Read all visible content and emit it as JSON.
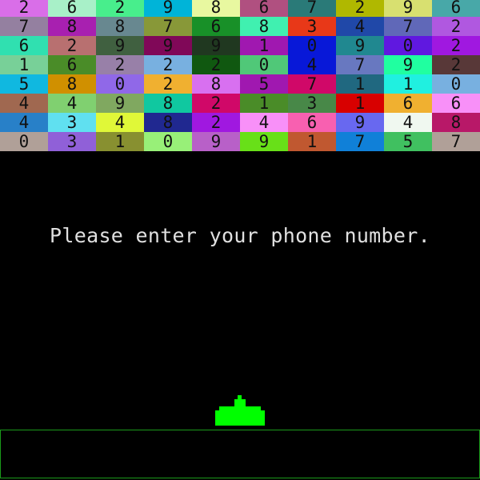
{
  "prompt": "Please enter your phone number.",
  "ship_color": "#00ff00",
  "input_border_color": "#1a9a1a",
  "bricks": [
    [
      {
        "d": "2",
        "c": "#d96ee8"
      },
      {
        "d": "6",
        "c": "#a8f0c8"
      },
      {
        "d": "2",
        "c": "#48ee8c"
      },
      {
        "d": "9",
        "c": "#00b4d8"
      },
      {
        "d": "8",
        "c": "#e8f8a0"
      },
      {
        "d": "6",
        "c": "#b05080"
      },
      {
        "d": "7",
        "c": "#2a7a78"
      },
      {
        "d": "2",
        "c": "#b0b800"
      },
      {
        "d": "9",
        "c": "#d8e070"
      },
      {
        "d": "6",
        "c": "#48a8a8"
      }
    ],
    [
      {
        "d": "7",
        "c": "#9480a0"
      },
      {
        "d": "8",
        "c": "#a820b0"
      },
      {
        "d": "8",
        "c": "#688890"
      },
      {
        "d": "7",
        "c": "#889838"
      },
      {
        "d": "6",
        "c": "#189028"
      },
      {
        "d": "8",
        "c": "#40f0b0"
      },
      {
        "d": "3",
        "c": "#e83818"
      },
      {
        "d": "4",
        "c": "#2048a8"
      },
      {
        "d": "7",
        "c": "#6068b8"
      },
      {
        "d": "2",
        "c": "#b058e0"
      }
    ],
    [
      {
        "d": "6",
        "c": "#30e0b0"
      },
      {
        "d": "2",
        "c": "#b87070"
      },
      {
        "d": "9",
        "c": "#406040"
      },
      {
        "d": "9",
        "c": "#800858"
      },
      {
        "d": "9",
        "c": "#203820"
      },
      {
        "d": "1",
        "c": "#a018b0"
      },
      {
        "d": "0",
        "c": "#0818d8"
      },
      {
        "d": "9",
        "c": "#208890"
      },
      {
        "d": "0",
        "c": "#6018e0"
      },
      {
        "d": "2",
        "c": "#a018e0"
      }
    ],
    [
      {
        "d": "1",
        "c": "#78d098"
      },
      {
        "d": "6",
        "c": "#4a8c28"
      },
      {
        "d": "2",
        "c": "#9880a8"
      },
      {
        "d": "2",
        "c": "#78b0e0"
      },
      {
        "d": "2",
        "c": "#105810"
      },
      {
        "d": "0",
        "c": "#50c878"
      },
      {
        "d": "4",
        "c": "#0818d8"
      },
      {
        "d": "7",
        "c": "#6878c0"
      },
      {
        "d": "9",
        "c": "#20ffa0"
      },
      {
        "d": "2",
        "c": "#583838"
      }
    ],
    [
      {
        "d": "5",
        "c": "#10b8e0"
      },
      {
        "d": "8",
        "c": "#d09000"
      },
      {
        "d": "0",
        "c": "#9068e8"
      },
      {
        "d": "2",
        "c": "#f0b030"
      },
      {
        "d": "8",
        "c": "#d870f0"
      },
      {
        "d": "5",
        "c": "#a018b0"
      },
      {
        "d": "7",
        "c": "#d00868"
      },
      {
        "d": "1",
        "c": "#206880"
      },
      {
        "d": "1",
        "c": "#20f0e0"
      },
      {
        "d": "0",
        "c": "#78b0e0"
      }
    ],
    [
      {
        "d": "4",
        "c": "#a06850"
      },
      {
        "d": "4",
        "c": "#80d070"
      },
      {
        "d": "9",
        "c": "#80a860"
      },
      {
        "d": "8",
        "c": "#10c8a0"
      },
      {
        "d": "2",
        "c": "#d00868"
      },
      {
        "d": "1",
        "c": "#4a8c28"
      },
      {
        "d": "3",
        "c": "#488848"
      },
      {
        "d": "1",
        "c": "#d80000"
      },
      {
        "d": "6",
        "c": "#f0b030"
      },
      {
        "d": "6",
        "c": "#f890f8"
      }
    ],
    [
      {
        "d": "4",
        "c": "#2880c8"
      },
      {
        "d": "3",
        "c": "#60e0f0"
      },
      {
        "d": "4",
        "c": "#e0f838"
      },
      {
        "d": "8",
        "c": "#202890"
      },
      {
        "d": "2",
        "c": "#a018e0"
      },
      {
        "d": "4",
        "c": "#f890f8"
      },
      {
        "d": "6",
        "c": "#f860b0"
      },
      {
        "d": "9",
        "c": "#6868f0"
      },
      {
        "d": "4",
        "c": "#f0f8f0"
      },
      {
        "d": "8",
        "c": "#b81868"
      }
    ],
    [
      {
        "d": "0",
        "c": "#b0a098"
      },
      {
        "d": "3",
        "c": "#9060d8"
      },
      {
        "d": "1",
        "c": "#889030"
      },
      {
        "d": "0",
        "c": "#98f078"
      },
      {
        "d": "9",
        "c": "#b860c8"
      },
      {
        "d": "9",
        "c": "#68e018"
      },
      {
        "d": "1",
        "c": "#c05830"
      },
      {
        "d": "7",
        "c": "#1080d8"
      },
      {
        "d": "5",
        "c": "#40c060"
      },
      {
        "d": "7",
        "c": "#b0a098"
      }
    ]
  ]
}
